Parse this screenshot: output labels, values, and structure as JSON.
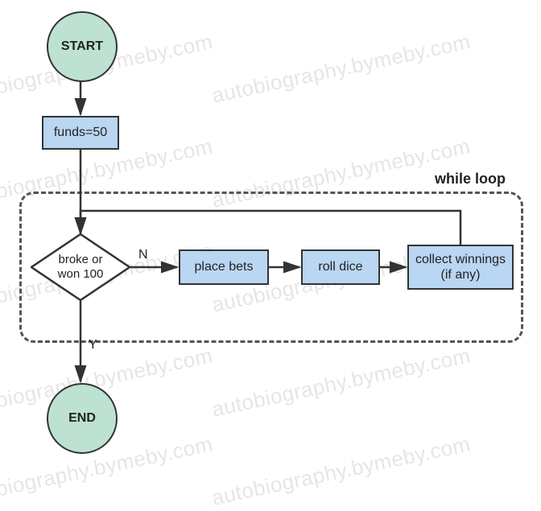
{
  "chart_data": {
    "type": "flowchart",
    "nodes": [
      {
        "id": "start",
        "kind": "terminal",
        "label": "START"
      },
      {
        "id": "init",
        "kind": "process",
        "label": "funds=50"
      },
      {
        "id": "cond",
        "kind": "decision",
        "label": "broke or\nwon 100"
      },
      {
        "id": "bets",
        "kind": "process",
        "label": "place bets"
      },
      {
        "id": "roll",
        "kind": "process",
        "label": "roll dice"
      },
      {
        "id": "coll",
        "kind": "process",
        "label": "collect winnings\n(if any)"
      },
      {
        "id": "end",
        "kind": "terminal",
        "label": "END"
      }
    ],
    "edges": [
      {
        "from": "start",
        "to": "init"
      },
      {
        "from": "init",
        "to": "cond"
      },
      {
        "from": "cond",
        "to": "bets",
        "label": "N"
      },
      {
        "from": "bets",
        "to": "roll"
      },
      {
        "from": "roll",
        "to": "coll"
      },
      {
        "from": "coll",
        "to": "cond",
        "feedback": true
      },
      {
        "from": "cond",
        "to": "end",
        "label": "Y"
      }
    ],
    "container": {
      "label": "while loop",
      "members": [
        "cond",
        "bets",
        "roll",
        "coll"
      ]
    }
  },
  "watermark": "autobiography.bymeby.com"
}
